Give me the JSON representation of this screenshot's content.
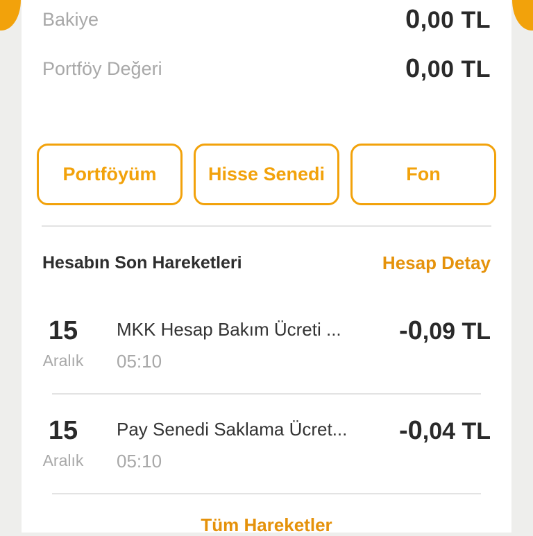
{
  "summary": {
    "balance_label": "Bakiye",
    "balance_int": "0",
    "balance_rest": ",00 TL",
    "portfolio_label": "Portföy Değeri",
    "portfolio_int": "0",
    "portfolio_rest": ",00 TL"
  },
  "actions": [
    {
      "label": "Portföyüm"
    },
    {
      "label": "Hisse Senedi"
    },
    {
      "label": "Fon"
    }
  ],
  "transactions_section": {
    "title": "Hesabın Son Hareketleri",
    "detail_link": "Hesap Detay"
  },
  "transactions": [
    {
      "day": "15",
      "month": "Aralık",
      "title": "MKK Hesap Bakım Ücreti ...",
      "time": "05:10",
      "amount_int": "-0",
      "amount_rest": ",09 TL"
    },
    {
      "day": "15",
      "month": "Aralık",
      "title": "Pay Senedi Saklama Ücret...",
      "time": "05:10",
      "amount_int": "-0",
      "amount_rest": ",04 TL"
    }
  ],
  "all_transactions_link": "Tüm Hareketler",
  "colors": {
    "accent": "#f2a20b",
    "link": "#e5920b",
    "text_dark": "#2a2a2a",
    "text_muted": "#a8a8a8",
    "background": "#eeeeec"
  }
}
